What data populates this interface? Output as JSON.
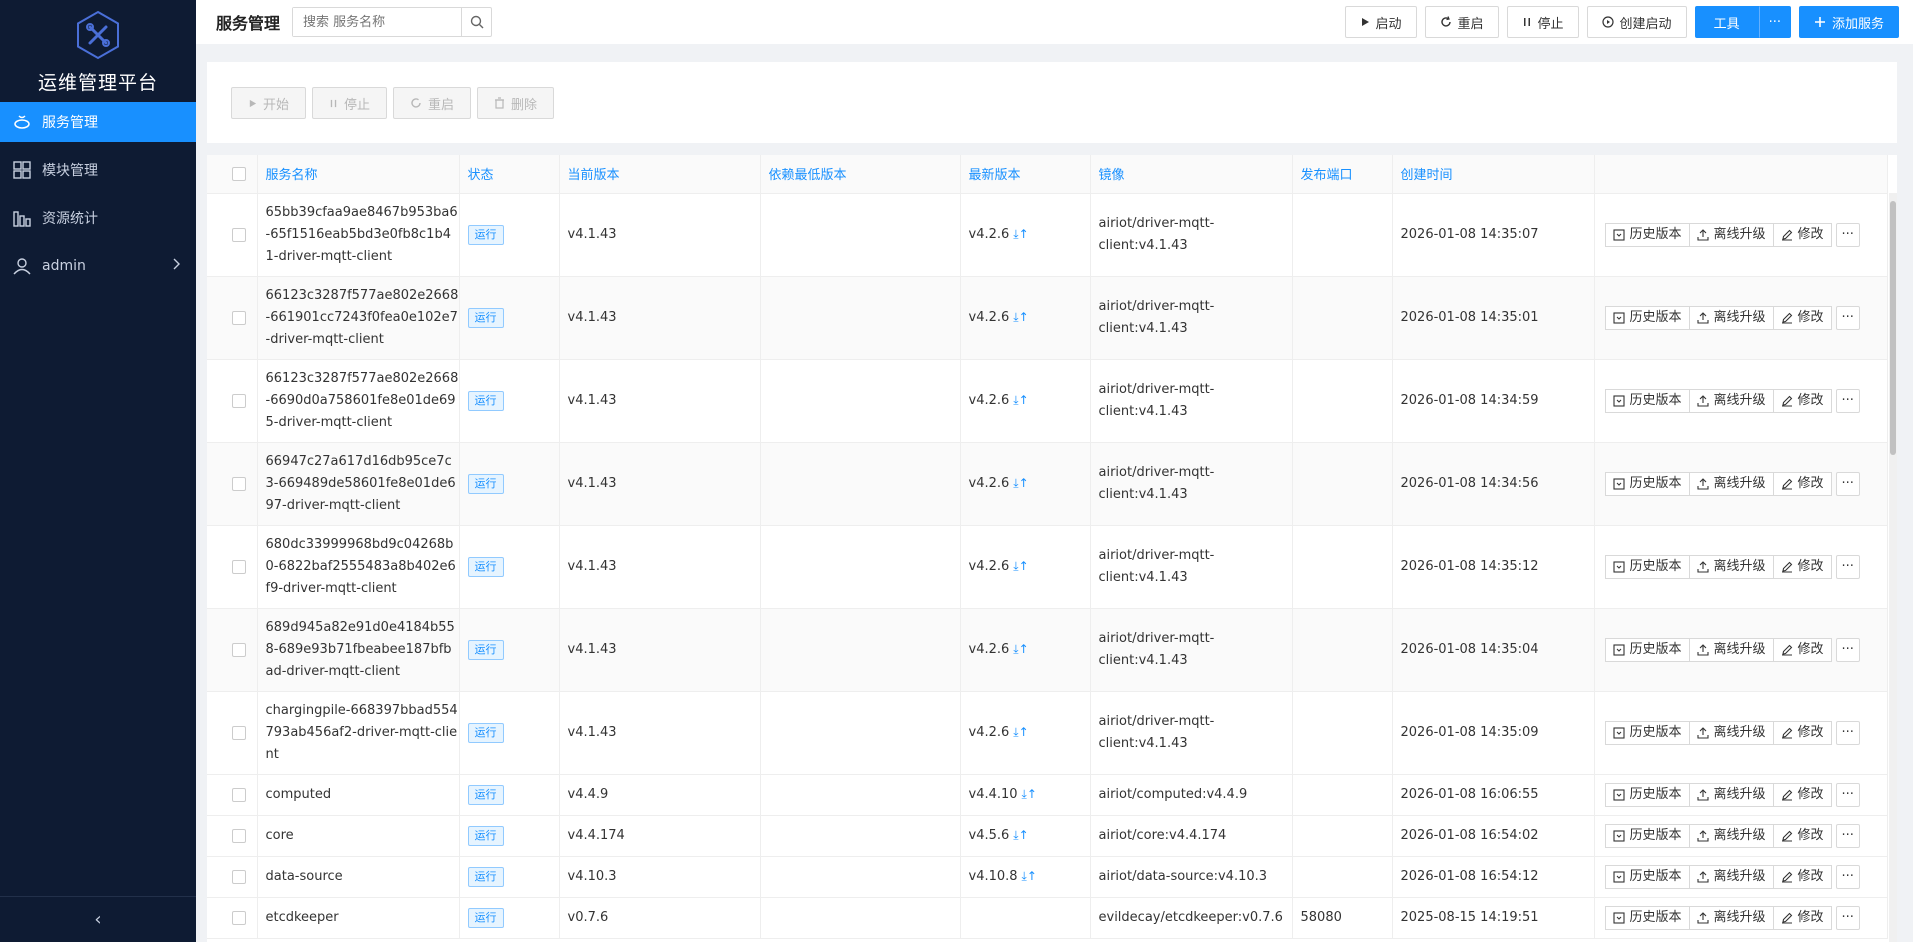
{
  "app": {
    "title": "运维管理平台"
  },
  "sidebar": {
    "items": [
      {
        "label": "服务管理",
        "icon": "service-icon",
        "active": true
      },
      {
        "label": "模块管理",
        "icon": "modules-icon",
        "active": false
      },
      {
        "label": "资源统计",
        "icon": "stats-icon",
        "active": false
      },
      {
        "label": "admin",
        "icon": "user-icon",
        "active": false
      }
    ],
    "collapse": "‹"
  },
  "header": {
    "title": "服务管理",
    "search_placeholder": "搜索 服务名称",
    "start": "启动",
    "restart": "重启",
    "stop": "停止",
    "create_start": "创建启动",
    "tools": "工具",
    "more": "···",
    "add": "添加服务"
  },
  "toolbar": {
    "start": "开始",
    "stop": "停止",
    "restart": "重启",
    "delete": "删除"
  },
  "table": {
    "columns": [
      "服务名称",
      "状态",
      "当前版本",
      "依赖最低版本",
      "最新版本",
      "镜像",
      "发布端口",
      "创建时间"
    ],
    "actions": {
      "history": "历史版本",
      "offline": "离线升级",
      "edit": "修改",
      "more": "···"
    },
    "rows": [
      {
        "name": "65bb39cfaa9ae8467b953ba6-65f1516eab5bd3e0fb8c1b41-driver-mqtt-client",
        "status": "运行",
        "current": "v4.1.43",
        "min": "",
        "latest": "v4.2.6",
        "image": "airiot/driver-mqtt-client:v4.1.43",
        "port": "",
        "created": "2026-01-08 14:35:07",
        "tall": true
      },
      {
        "name": "66123c3287f577ae802e2668-661901cc7243f0fea0e102e7-driver-mqtt-client",
        "status": "运行",
        "current": "v4.1.43",
        "min": "",
        "latest": "v4.2.6",
        "image": "airiot/driver-mqtt-client:v4.1.43",
        "port": "",
        "created": "2026-01-08 14:35:01",
        "tall": true
      },
      {
        "name": "66123c3287f577ae802e2668-6690d0a758601fe8e01de695-driver-mqtt-client",
        "status": "运行",
        "current": "v4.1.43",
        "min": "",
        "latest": "v4.2.6",
        "image": "airiot/driver-mqtt-client:v4.1.43",
        "port": "",
        "created": "2026-01-08 14:34:59",
        "tall": true
      },
      {
        "name": "66947c27a617d16db95ce7c3-669489de58601fe8e01de697-driver-mqtt-client",
        "status": "运行",
        "current": "v4.1.43",
        "min": "",
        "latest": "v4.2.6",
        "image": "airiot/driver-mqtt-client:v4.1.43",
        "port": "",
        "created": "2026-01-08 14:34:56",
        "tall": true
      },
      {
        "name": "680dc33999968bd9c04268b0-6822baf2555483a8b402e6f9-driver-mqtt-client",
        "status": "运行",
        "current": "v4.1.43",
        "min": "",
        "latest": "v4.2.6",
        "image": "airiot/driver-mqtt-client:v4.1.43",
        "port": "",
        "created": "2026-01-08 14:35:12",
        "tall": true
      },
      {
        "name": "689d945a82e91d0e4184b558-689e93b71fbeabee187bfbad-driver-mqtt-client",
        "status": "运行",
        "current": "v4.1.43",
        "min": "",
        "latest": "v4.2.6",
        "image": "airiot/driver-mqtt-client:v4.1.43",
        "port": "",
        "created": "2026-01-08 14:35:04",
        "tall": true
      },
      {
        "name": "chargingpile-668397bbad554793ab456af2-driver-mqtt-client",
        "status": "运行",
        "current": "v4.1.43",
        "min": "",
        "latest": "v4.2.6",
        "image": "airiot/driver-mqtt-client:v4.1.43",
        "port": "",
        "created": "2026-01-08 14:35:09",
        "tall": true
      },
      {
        "name": "computed",
        "status": "运行",
        "current": "v4.4.9",
        "min": "",
        "latest": "v4.4.10",
        "image": "airiot/computed:v4.4.9",
        "port": "",
        "created": "2026-01-08 16:06:55",
        "tall": false
      },
      {
        "name": "core",
        "status": "运行",
        "current": "v4.4.174",
        "min": "",
        "latest": "v4.5.6",
        "image": "airiot/core:v4.4.174",
        "port": "",
        "created": "2026-01-08 16:54:02",
        "tall": false
      },
      {
        "name": "data-source",
        "status": "运行",
        "current": "v4.10.3",
        "min": "",
        "latest": "v4.10.8",
        "image": "airiot/data-source:v4.10.3",
        "port": "",
        "created": "2026-01-08 16:54:12",
        "tall": false
      },
      {
        "name": "etcdkeeper",
        "status": "运行",
        "current": "v0.7.6",
        "min": "",
        "latest": "",
        "image": "evildecay/etcdkeeper:v0.7.6",
        "port": "58080",
        "created": "2025-08-15 14:19:51",
        "tall": false
      }
    ]
  },
  "colors": {
    "accent": "#1890ff",
    "sidebar": "#0e1b33"
  }
}
